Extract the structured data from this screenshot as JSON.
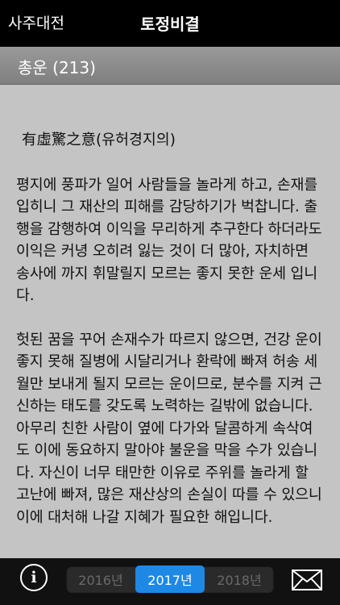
{
  "nav": {
    "back_label": "사주대전",
    "title": "토정비결"
  },
  "section": {
    "title": "총운 (213)"
  },
  "fortune": {
    "title": "有虛驚之意(유허경지의)",
    "paragraphs": [
      "평지에 풍파가 일어 사람들을 놀라게 하고, 손재를 입히니 그 재산의 피해를 감당하기가 벅찹니다. 출행을 감행하여 이익을 무리하게 추구한다 하더라도 이익은 커녕 오히려 잃는 것이 더 많아, 자치하면 송사에 까지 휘말릴지 모르는 좋지 못한 운세 입니다.",
      "헛된 꿈을 꾸어 손재수가 따르지 않으면, 건강 운이 좋지 못해 질병에 시달리거나 환락에 빠져 허송 세월만 보내게 될지 모르는 운이므로, 분수를 지켜 근신하는 태도를 갖도록 노력하는 길밖에 없습니다. 아무리 친한 사람이 옆에 다가와 달콤하게 속삭여도 이에 동요하지 말아야 불운을 막을 수가 있습니다. 자신이 너무 태만한 이유로 주위를 놀라게 할 고난에 빠져, 많은 재산상의 손실이 따를 수 있으니 이에 대처해 나갈 지혜가 필요한 해입니다."
    ]
  },
  "toolbar": {
    "info_icon": "info-icon",
    "info_glyph": "i",
    "years": [
      "2016년",
      "2017년",
      "2018년"
    ],
    "selected_year": "2017년",
    "mail_icon": "mail-icon"
  },
  "colors": {
    "accent": "#1e88e5",
    "content_bg": "#c4c4c4",
    "header_bg": "#8c8c8c"
  }
}
